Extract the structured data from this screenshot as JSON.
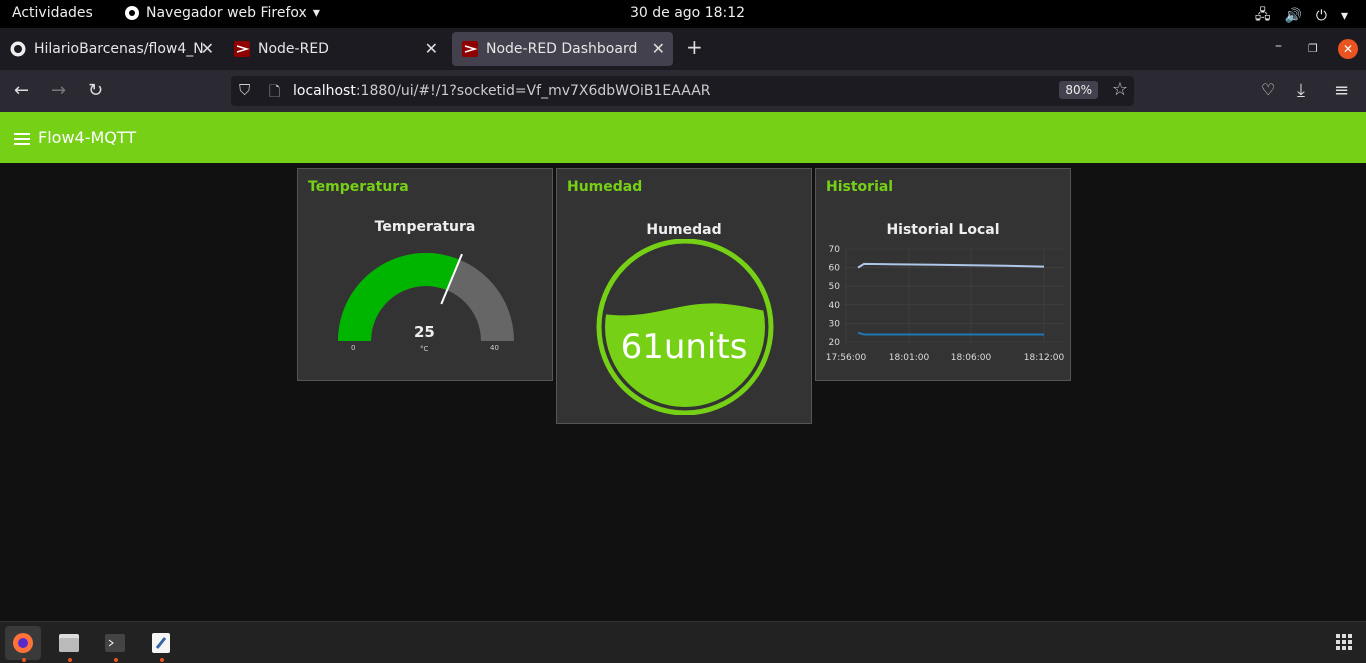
{
  "topbar": {
    "activities": "Actividades",
    "app_name": "Navegador web Firefox",
    "clock": "30 de ago  18:12"
  },
  "tabs": [
    {
      "title": "HilarioBarcenas/flow4_N",
      "icon": "github-icon"
    },
    {
      "title": "Node-RED",
      "icon": "node-red-icon"
    },
    {
      "title": "Node-RED Dashboard",
      "icon": "node-red-icon",
      "active": true
    }
  ],
  "urlbar": {
    "host": "localhost",
    "rest": ":1880/ui/#!/1?socketid=Vf_mv7X6dbWOiB1EAAAR",
    "zoom": "80%"
  },
  "dashboard": {
    "title": "Flow4-MQTT",
    "accent": "#76d116"
  },
  "cards": {
    "temperatura": {
      "header": "Temperatura",
      "widget_title": "Temperatura",
      "value": "25",
      "unit": "°C",
      "min": "0",
      "max": "40",
      "value_num": 25,
      "min_num": 0,
      "max_num": 40
    },
    "humedad": {
      "header": "Humedad",
      "widget_title": "Humedad",
      "value_text": "61units",
      "level": 0.61
    },
    "historial": {
      "header": "Historial",
      "widget_title": "Historial Local"
    }
  },
  "chart_data": {
    "type": "line",
    "title": "Historial Local",
    "x": [
      "17:56:00",
      "18:01:00",
      "18:06:00",
      "18:12:00"
    ],
    "ylim": [
      20,
      70
    ],
    "yticks": [
      "70",
      "60",
      "50",
      "40",
      "30",
      "20"
    ],
    "series": [
      {
        "values": [
          60,
          62,
          61.5,
          61,
          60.5
        ],
        "color": "#aec7e8"
      },
      {
        "values": [
          25,
          24,
          24,
          24,
          24
        ],
        "color": "#1f77b4"
      }
    ],
    "grid": true
  }
}
